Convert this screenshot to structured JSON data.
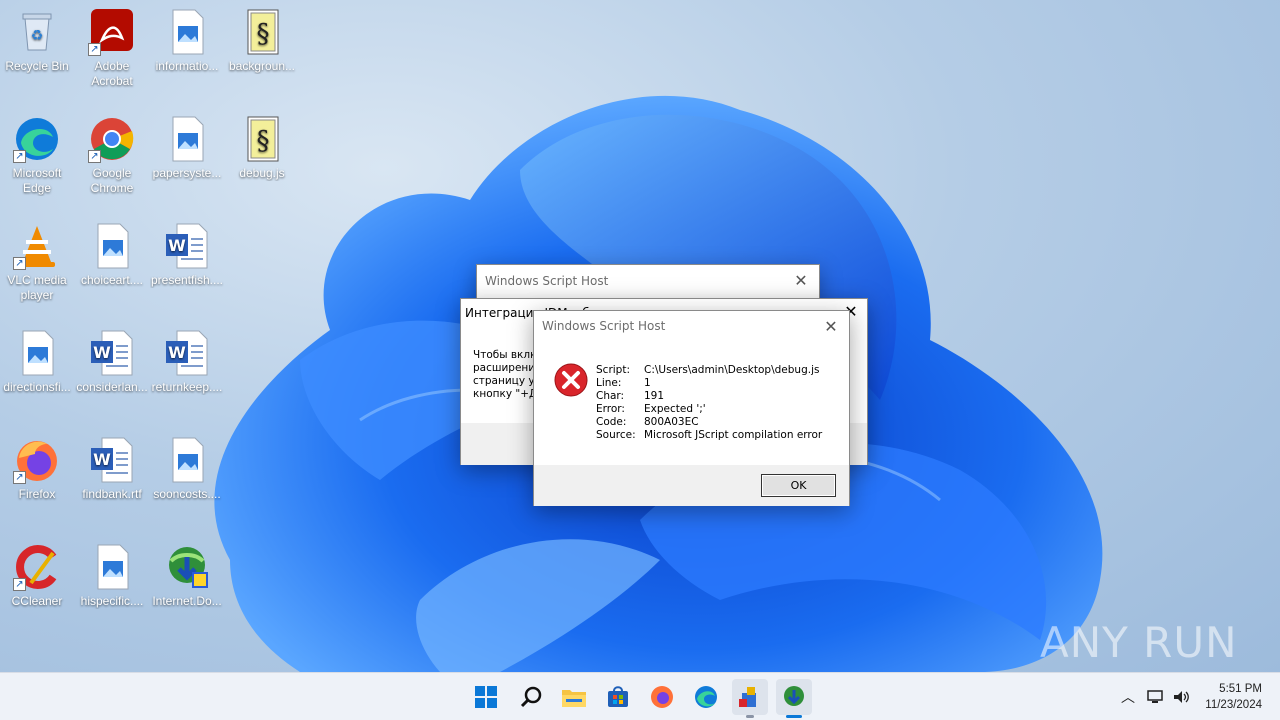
{
  "desktop": {
    "icons": [
      {
        "label": "Recycle Bin",
        "icon": "recycle-bin-icon"
      },
      {
        "label": "Adobe Acrobat",
        "icon": "adobe-acrobat-icon"
      },
      {
        "label": "informatio...",
        "icon": "image-file-icon"
      },
      {
        "label": "backgroun...",
        "icon": "script-file-icon"
      },
      {
        "label": "Microsoft Edge",
        "icon": "edge-icon"
      },
      {
        "label": "Google Chrome",
        "icon": "chrome-icon"
      },
      {
        "label": "papersyste...",
        "icon": "image-file-icon"
      },
      {
        "label": "debug.js",
        "icon": "script-file-icon"
      },
      {
        "label": "VLC media player",
        "icon": "vlc-icon"
      },
      {
        "label": "choiceart....",
        "icon": "image-file-icon"
      },
      {
        "label": "presentfish....",
        "icon": "word-file-icon"
      },
      {
        "label": "directionsfi...",
        "icon": "image-file-icon"
      },
      {
        "label": "considerlan...",
        "icon": "word-file-icon"
      },
      {
        "label": "returnkeep....",
        "icon": "word-file-icon"
      },
      {
        "label": "Firefox",
        "icon": "firefox-icon"
      },
      {
        "label": "findbank.rtf",
        "icon": "word-file-icon"
      },
      {
        "label": "sooncosts....",
        "icon": "image-file-icon"
      },
      {
        "label": "CCleaner",
        "icon": "ccleaner-icon"
      },
      {
        "label": "hispecific....",
        "icon": "image-file-icon"
      },
      {
        "label": "Internet.Do...",
        "icon": "idm-icon"
      }
    ]
  },
  "dialog_back": {
    "title": "Windows Script Host"
  },
  "dialog_idm": {
    "title": "Интеграция IDM в б",
    "text_lines": [
      "Чтобы вклк",
      "расширени",
      "страницу ус",
      "кнопку \"+Д"
    ]
  },
  "dialog_error": {
    "title": "Windows Script Host",
    "fields": [
      {
        "key": "Script:",
        "value": "C:\\Users\\admin\\Desktop\\debug.js"
      },
      {
        "key": "Line:",
        "value": "1"
      },
      {
        "key": "Char:",
        "value": "191"
      },
      {
        "key": "Error:",
        "value": "Expected ';'"
      },
      {
        "key": "Code:",
        "value": "800A03EC"
      },
      {
        "key": "Source:",
        "value": "Microsoft JScript compilation error"
      }
    ],
    "ok_label": "OK"
  },
  "taskbar": {
    "items": [
      "windows-start-icon",
      "search-icon",
      "file-explorer-icon",
      "store-icon",
      "firefox-icon",
      "edge-icon",
      "script-host-icon",
      "idm-icon"
    ],
    "time": "5:51 PM",
    "date": "11/23/2024"
  },
  "watermark": "ANY RUN",
  "colors": {
    "wallpaper_bloom": "#1560e8",
    "error_red": "#d9252b"
  }
}
